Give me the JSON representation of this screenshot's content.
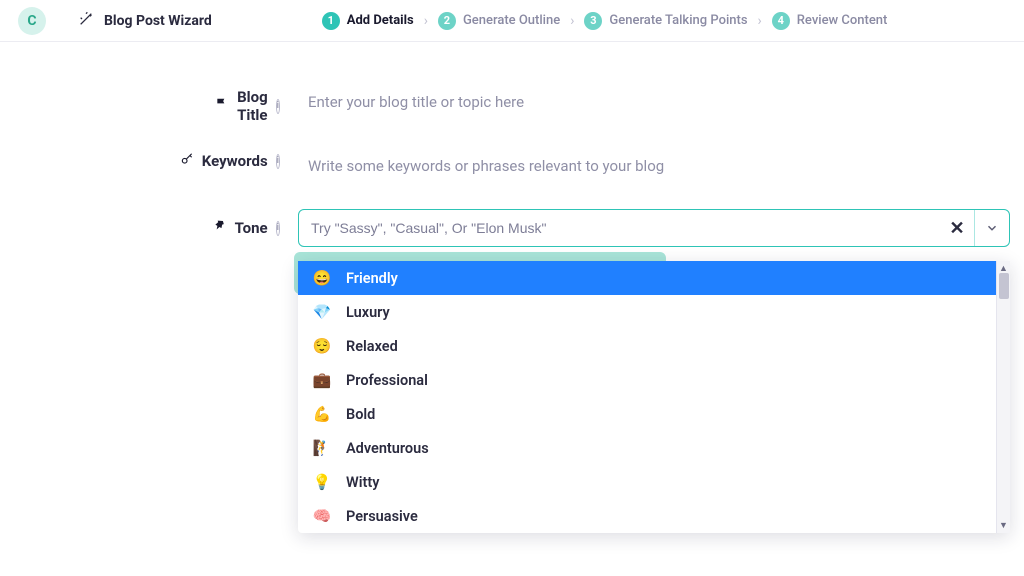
{
  "logo_letter": "C",
  "wizard_title": "Blog Post Wizard",
  "steps": [
    {
      "num": "1",
      "label": "Add Details"
    },
    {
      "num": "2",
      "label": "Generate Outline"
    },
    {
      "num": "3",
      "label": "Generate Talking Points"
    },
    {
      "num": "4",
      "label": "Review Content"
    }
  ],
  "fields": {
    "title": {
      "label": "Blog Title",
      "placeholder": "Enter your blog title or topic here"
    },
    "keywords": {
      "label": "Keywords",
      "placeholder": "Write some keywords or phrases relevant to your blog"
    },
    "tone": {
      "label": "Tone",
      "placeholder": "Try \"Sassy\", \"Casual\", Or \"Elon Musk\""
    }
  },
  "tone_options": [
    {
      "emoji": "😄",
      "label": "Friendly"
    },
    {
      "emoji": "💎",
      "label": "Luxury"
    },
    {
      "emoji": "😌",
      "label": "Relaxed"
    },
    {
      "emoji": "💼",
      "label": "Professional"
    },
    {
      "emoji": "💪",
      "label": "Bold"
    },
    {
      "emoji": "🧗",
      "label": "Adventurous"
    },
    {
      "emoji": "💡",
      "label": "Witty"
    },
    {
      "emoji": "🧠",
      "label": "Persuasive"
    }
  ]
}
